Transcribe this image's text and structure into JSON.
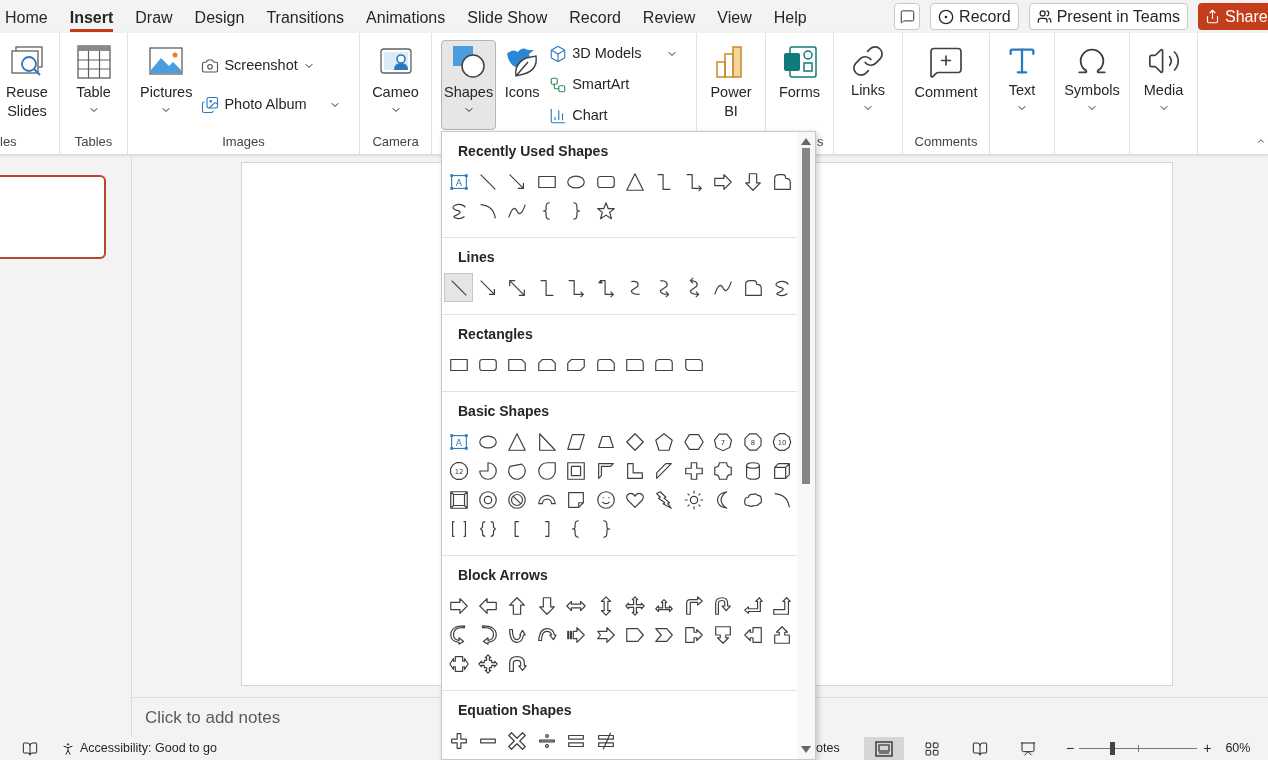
{
  "menu_tabs": [
    {
      "label": "Home",
      "selected": false
    },
    {
      "label": "Insert",
      "selected": true
    },
    {
      "label": "Draw",
      "selected": false
    },
    {
      "label": "Design",
      "selected": false
    },
    {
      "label": "Transitions",
      "selected": false
    },
    {
      "label": "Animations",
      "selected": false
    },
    {
      "label": "Slide Show",
      "selected": false
    },
    {
      "label": "Record",
      "selected": false
    },
    {
      "label": "Review",
      "selected": false
    },
    {
      "label": "View",
      "selected": false
    },
    {
      "label": "Help",
      "selected": false
    }
  ],
  "title_buttons": {
    "record": "Record",
    "teams": "Present in Teams",
    "share": "Share"
  },
  "ribbon": {
    "groups": [
      {
        "label": "les",
        "items": [
          {
            "kind": "large",
            "label": "Reuse Slides",
            "has_menu": false,
            "pressed": false
          }
        ]
      },
      {
        "label": "Tables",
        "items": [
          {
            "kind": "large",
            "label": "Table",
            "has_menu": true,
            "pressed": false
          }
        ]
      },
      {
        "label": "Images",
        "items": [
          {
            "kind": "large",
            "label": "Pictures",
            "has_menu": true,
            "pressed": false
          },
          {
            "kind": "stack",
            "items": [
              {
                "label": "Screenshot",
                "has_menu": true,
                "split": false
              },
              {
                "label": "Photo Album",
                "has_menu": true,
                "split": true
              }
            ]
          }
        ]
      },
      {
        "label": "Camera",
        "items": [
          {
            "kind": "large",
            "label": "Cameo",
            "has_menu": true,
            "pressed": false
          }
        ]
      },
      {
        "items": [
          {
            "kind": "large",
            "label": "Shapes",
            "has_menu": true,
            "pressed": true
          },
          {
            "kind": "large",
            "label": "Icons",
            "has_menu": false,
            "pressed": false
          },
          {
            "kind": "stack",
            "items": [
              {
                "label": "3D Models",
                "has_menu": true,
                "split": true
              },
              {
                "label": "SmartArt",
                "has_menu": false
              },
              {
                "label": "Chart",
                "has_menu": false
              }
            ]
          }
        ]
      },
      {
        "items": [
          {
            "kind": "large",
            "label": "Power BI",
            "has_menu": false,
            "pressed": false
          }
        ]
      },
      {
        "label": "s",
        "items": [
          {
            "kind": "large",
            "label": "Forms",
            "has_menu": false,
            "pressed": false
          }
        ]
      },
      {
        "items": [
          {
            "kind": "large",
            "label": "Links",
            "has_menu": true,
            "pressed": false
          }
        ]
      },
      {
        "label": "Comments",
        "items": [
          {
            "kind": "large",
            "label": "Comment",
            "has_menu": false,
            "pressed": false
          }
        ]
      },
      {
        "items": [
          {
            "kind": "large",
            "label": "Text",
            "has_menu": true,
            "pressed": false
          }
        ]
      },
      {
        "items": [
          {
            "kind": "large",
            "label": "Symbols",
            "has_menu": true,
            "pressed": false
          }
        ]
      },
      {
        "items": [
          {
            "kind": "large",
            "label": "Media",
            "has_menu": true,
            "pressed": false
          }
        ]
      }
    ]
  },
  "shapes_gallery": {
    "sections": [
      {
        "title": "Recently Used Shapes",
        "shapes": [
          {
            "kind": "textbox",
            "label": "A",
            "selected": false
          },
          {
            "kind": "line",
            "selected": false
          },
          {
            "kind": "arrow-line",
            "selected": false
          },
          {
            "kind": "rect",
            "selected": false
          },
          {
            "kind": "oval",
            "selected": false
          },
          {
            "kind": "rounded-rect",
            "selected": false
          },
          {
            "kind": "triangle",
            "selected": false
          },
          {
            "kind": "elbow",
            "selected": false
          },
          {
            "kind": "elbow-arrow",
            "selected": false
          },
          {
            "kind": "right-arrow",
            "selected": false
          },
          {
            "kind": "down-arrow",
            "selected": false
          },
          {
            "kind": "freeform",
            "selected": false
          },
          {
            "kind": "scribble",
            "selected": false
          },
          {
            "kind": "arc",
            "selected": false
          },
          {
            "kind": "curve",
            "selected": false
          },
          {
            "kind": "left-brace",
            "selected": false
          },
          {
            "kind": "right-brace",
            "selected": false
          },
          {
            "kind": "star",
            "selected": false
          }
        ]
      },
      {
        "title": "Lines",
        "shapes": [
          {
            "kind": "line",
            "selected": true
          },
          {
            "kind": "arrow-line",
            "selected": false
          },
          {
            "kind": "double-arrow-line",
            "selected": false
          },
          {
            "kind": "elbow",
            "selected": false
          },
          {
            "kind": "elbow-arrow",
            "selected": false
          },
          {
            "kind": "elbow-double-arrow",
            "selected": false
          },
          {
            "kind": "curved-connector",
            "selected": false
          },
          {
            "kind": "curved-arrow-connector",
            "selected": false
          },
          {
            "kind": "curved-double-arrow",
            "selected": false
          },
          {
            "kind": "curve",
            "selected": false
          },
          {
            "kind": "freeform",
            "selected": false
          },
          {
            "kind": "scribble",
            "selected": false
          }
        ]
      },
      {
        "title": "Rectangles",
        "shapes": [
          {
            "kind": "rect",
            "selected": false
          },
          {
            "kind": "rounded-rect",
            "selected": false
          },
          {
            "kind": "snip-one",
            "selected": false
          },
          {
            "kind": "snip-same",
            "selected": false
          },
          {
            "kind": "snip-diag",
            "selected": false
          },
          {
            "kind": "snip-round",
            "selected": false
          },
          {
            "kind": "round-one",
            "selected": false
          },
          {
            "kind": "round-same",
            "selected": false
          },
          {
            "kind": "round-diag",
            "selected": false
          }
        ]
      },
      {
        "title": "Basic Shapes",
        "shapes": [
          {
            "kind": "textbox",
            "label": "A",
            "selected": false
          },
          {
            "kind": "oval",
            "selected": false
          },
          {
            "kind": "triangle",
            "selected": false
          },
          {
            "kind": "right-triangle",
            "selected": false
          },
          {
            "kind": "parallelogram",
            "selected": false
          },
          {
            "kind": "trapezoid",
            "selected": false
          },
          {
            "kind": "diamond",
            "selected": false
          },
          {
            "kind": "pentagon",
            "selected": false
          },
          {
            "kind": "hexagon",
            "selected": false
          },
          {
            "kind": "heptagon",
            "label": "7",
            "selected": false
          },
          {
            "kind": "octagon",
            "label": "8",
            "selected": false
          },
          {
            "kind": "decagon",
            "label": "10",
            "selected": false
          },
          {
            "kind": "dodecagon",
            "label": "12",
            "selected": false
          },
          {
            "kind": "pie",
            "selected": false
          },
          {
            "kind": "chord",
            "selected": false
          },
          {
            "kind": "teardrop",
            "selected": false
          },
          {
            "kind": "frame",
            "selected": false
          },
          {
            "kind": "half-frame",
            "selected": false
          },
          {
            "kind": "l-shape",
            "selected": false
          },
          {
            "kind": "diagonal-stripe",
            "selected": false
          },
          {
            "kind": "cross",
            "selected": false
          },
          {
            "kind": "plaque",
            "selected": false
          },
          {
            "kind": "can",
            "selected": false
          },
          {
            "kind": "cube",
            "selected": false
          },
          {
            "kind": "bevel",
            "selected": false
          },
          {
            "kind": "donut",
            "selected": false
          },
          {
            "kind": "no-symbol",
            "selected": false
          },
          {
            "kind": "block-arc",
            "selected": false
          },
          {
            "kind": "folded-corner",
            "selected": false
          },
          {
            "kind": "smiley",
            "selected": false
          },
          {
            "kind": "heart",
            "selected": false
          },
          {
            "kind": "lightning",
            "selected": false
          },
          {
            "kind": "sun",
            "selected": false
          },
          {
            "kind": "moon",
            "selected": false
          },
          {
            "kind": "cloud",
            "selected": false
          },
          {
            "kind": "arc",
            "selected": false
          },
          {
            "kind": "double-bracket",
            "selected": false
          },
          {
            "kind": "double-brace",
            "selected": false
          },
          {
            "kind": "left-bracket",
            "selected": false
          },
          {
            "kind": "right-bracket",
            "selected": false
          },
          {
            "kind": "left-brace",
            "selected": false
          },
          {
            "kind": "right-brace",
            "selected": false
          }
        ]
      },
      {
        "title": "Block Arrows",
        "shapes": [
          {
            "kind": "right-arrow",
            "selected": false
          },
          {
            "kind": "left-arrow",
            "selected": false
          },
          {
            "kind": "up-arrow",
            "selected": false
          },
          {
            "kind": "down-arrow",
            "selected": false
          },
          {
            "kind": "left-right-arrow",
            "selected": false
          },
          {
            "kind": "up-down-arrow",
            "selected": false
          },
          {
            "kind": "quad-arrow",
            "selected": false
          },
          {
            "kind": "left-right-up-arrow",
            "selected": false
          },
          {
            "kind": "bent-arrow",
            "selected": false
          },
          {
            "kind": "u-turn-arrow",
            "selected": false
          },
          {
            "kind": "left-up-arrow",
            "selected": false
          },
          {
            "kind": "bent-up-arrow",
            "selected": false
          },
          {
            "kind": "curved-right-arrow",
            "selected": false
          },
          {
            "kind": "curved-left-arrow",
            "selected": false
          },
          {
            "kind": "curved-up-arrow",
            "selected": false
          },
          {
            "kind": "curved-down-arrow",
            "selected": false
          },
          {
            "kind": "striped-right-arrow",
            "selected": false
          },
          {
            "kind": "notched-right-arrow",
            "selected": false
          },
          {
            "kind": "pentagon-arrow",
            "selected": false
          },
          {
            "kind": "chevron",
            "selected": false
          },
          {
            "kind": "right-callout",
            "selected": false
          },
          {
            "kind": "down-callout",
            "selected": false
          },
          {
            "kind": "left-callout",
            "selected": false
          },
          {
            "kind": "up-callout",
            "selected": false
          },
          {
            "kind": "left-right-callout",
            "selected": false
          },
          {
            "kind": "quad-callout",
            "selected": false
          },
          {
            "kind": "circular-arrow",
            "selected": false
          }
        ]
      },
      {
        "title": "Equation Shapes",
        "shapes": [
          {
            "kind": "plus",
            "selected": false
          },
          {
            "kind": "minus",
            "selected": false
          },
          {
            "kind": "multiply",
            "selected": false
          },
          {
            "kind": "divide",
            "selected": false
          },
          {
            "kind": "equal",
            "selected": false
          },
          {
            "kind": "not-equal",
            "selected": false
          }
        ]
      }
    ]
  },
  "notes": {
    "placeholder": "Click to add notes"
  },
  "status_bar": {
    "accessibility": "Accessibility: Good to go",
    "notes_button": "otes",
    "views": [
      {
        "selected": true
      },
      {
        "selected": false
      },
      {
        "selected": false
      },
      {
        "selected": false
      }
    ],
    "zoom": {
      "minus": "−",
      "plus": "+",
      "level": 0.28,
      "reading": "60%"
    }
  }
}
